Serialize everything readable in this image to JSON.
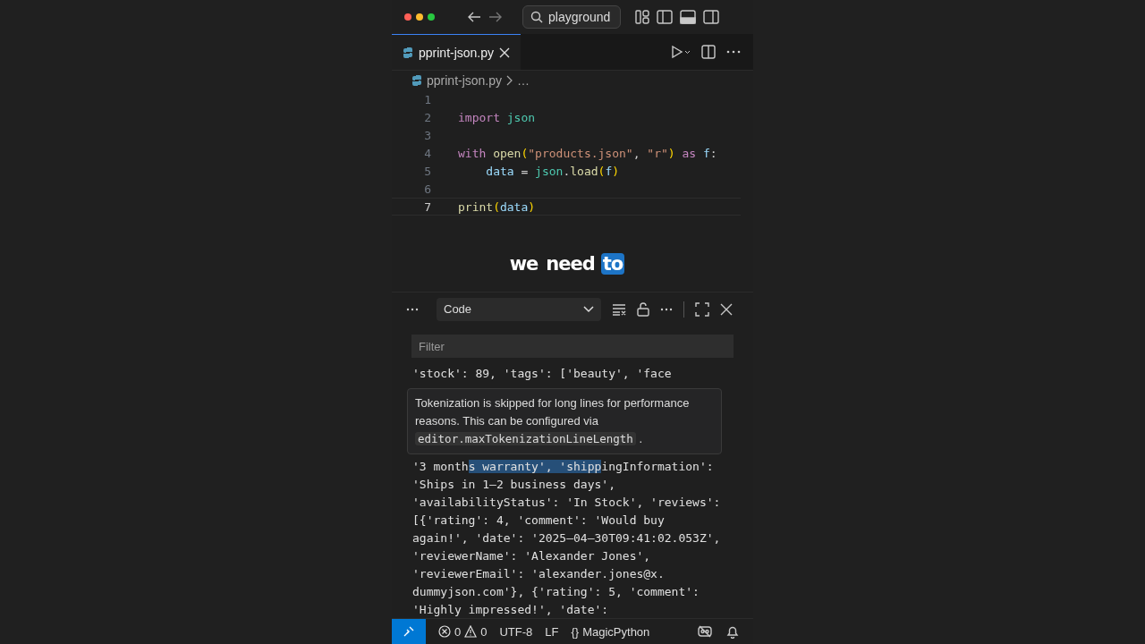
{
  "titlebar": {
    "search": "playground"
  },
  "tabs": [
    {
      "label": "pprint-json.py",
      "selected": true
    }
  ],
  "breadcrumbs": [
    "pprint-json.py",
    "…"
  ],
  "editor": {
    "lines": [
      {
        "number": "1",
        "current": false
      },
      {
        "number": "2",
        "current": false,
        "tokens": [
          {
            "kind": "keyword",
            "text": "import"
          },
          {
            "kind": "module",
            "text": " json"
          }
        ]
      },
      {
        "number": "3",
        "current": false
      },
      {
        "number": "4",
        "current": false,
        "tokens": [
          {
            "kind": "keyword",
            "text": "with"
          },
          {
            "kind": "func",
            "text": " open"
          },
          {
            "kind": "paren",
            "text": "("
          },
          {
            "kind": "string",
            "text": "\"products.json\""
          },
          {
            "kind": "plain",
            "text": ", "
          },
          {
            "kind": "string",
            "text": "\"r\""
          },
          {
            "kind": "paren",
            "text": ")"
          },
          {
            "kind": "keyword",
            "text": " as"
          },
          {
            "kind": "var",
            "text": " f"
          },
          {
            "kind": "plain",
            "text": ":"
          }
        ]
      },
      {
        "number": "5",
        "current": false,
        "tokens": [
          {
            "kind": "var",
            "text": "    data"
          },
          {
            "kind": "plain",
            "text": " = "
          },
          {
            "kind": "module",
            "text": "json"
          },
          {
            "kind": "plain",
            "text": "."
          },
          {
            "kind": "func",
            "text": "load"
          },
          {
            "kind": "paren",
            "text": "("
          },
          {
            "kind": "var",
            "text": "f"
          },
          {
            "kind": "paren",
            "text": ")"
          }
        ]
      },
      {
        "number": "6",
        "current": false
      },
      {
        "number": "7",
        "current": true,
        "tokens": [
          {
            "kind": "func",
            "text": "print"
          },
          {
            "kind": "paren",
            "text": "("
          },
          {
            "kind": "var",
            "text": "data"
          },
          {
            "kind": "paren",
            "text": ")"
          }
        ]
      }
    ]
  },
  "caption": [
    {
      "text": "we",
      "highlighted": false
    },
    {
      "text": "need",
      "highlighted": false
    },
    {
      "text": "to",
      "highlighted": true
    }
  ],
  "panel": {
    "dropdown": "Code",
    "filter_placeholder": "Filter",
    "output_before": [
      "'stock': 89, 'tags': ['beauty', 'face"
    ],
    "tooltip": {
      "text": "Tokenization is skipped for long lines for performance reasons. This can be configured via",
      "setting": "editor.maxTokenizationLineLength",
      "end": "."
    },
    "output_after": [
      [
        {
          "text": "'3 month",
          "selected": false
        },
        {
          "text": "s warranty', 'shipp",
          "selected": true
        },
        {
          "text": "ingInformation':",
          "selected": false
        }
      ],
      [
        {
          "text": "'Ships in 1–2 business days',",
          "selected": false
        }
      ],
      [
        {
          "text": "'availabilityStatus': 'In Stock', 'reviews':",
          "selected": false
        }
      ],
      [
        {
          "text": "[{'rating': 4, 'comment': 'Would buy",
          "selected": false
        }
      ],
      [
        {
          "text": "again!', 'date': '2025–04–30T09:41:02.053Z',",
          "selected": false
        }
      ],
      [
        {
          "text": "'reviewerName': 'Alexander Jones',",
          "selected": false
        }
      ],
      [
        {
          "text": "'reviewerEmail': 'alexander.jones@x.",
          "selected": false
        }
      ],
      [
        {
          "text": "dummyjson.com'}, {'rating': 5, 'comment':",
          "selected": false
        }
      ],
      [
        {
          "text": "'Highly impressed!', 'date':",
          "selected": false
        }
      ]
    ]
  },
  "status_bar": {
    "errors": "0",
    "warnings": "0",
    "encoding": "UTF-8",
    "eol": "LF",
    "language_icon": "{}",
    "language": "MagicPython"
  }
}
